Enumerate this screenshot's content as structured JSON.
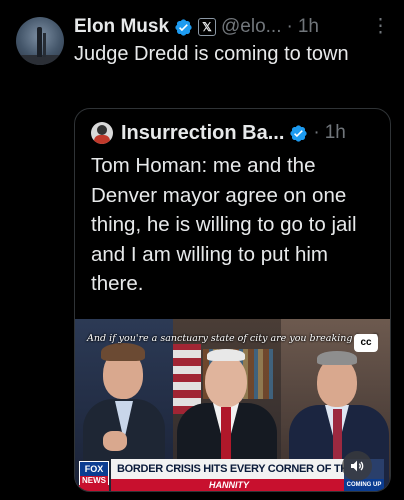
{
  "tweet": {
    "author_name": "Elon Musk",
    "handle": "@elo...",
    "separator": "·",
    "time": "1h",
    "more_icon": "⋮",
    "affiliation_badge": "𝕏",
    "text": "Judge Dredd is coming to town"
  },
  "quoted_tweet": {
    "author_name": "Insurrection Ba...",
    "separator": "·",
    "time": "1h",
    "text": "Tom Homan: me and the Denver mayor agree on one thing, he is willing to go to jail and I am willing to put him there."
  },
  "video": {
    "caption": "And if you're a sanctuary state of city are you breaking law?",
    "cc_label": "cc",
    "network_logo_top": "FOX",
    "network_logo_bottom": "NEWS",
    "chyron": "BORDER CRISIS HITS EVERY CORNER OF THE U.S.",
    "show_name": "HANNITY",
    "coming_up": "COMING UP"
  },
  "colors": {
    "verified_blue": "#1d9bf0",
    "muted_text": "#71767b",
    "text": "#e7e9ea",
    "background": "#000000",
    "border": "#2f3336"
  },
  "icons": {
    "verified": "verified-badge-icon",
    "more": "more-options-icon",
    "volume": "volume-icon",
    "cc": "closed-captions-icon"
  }
}
